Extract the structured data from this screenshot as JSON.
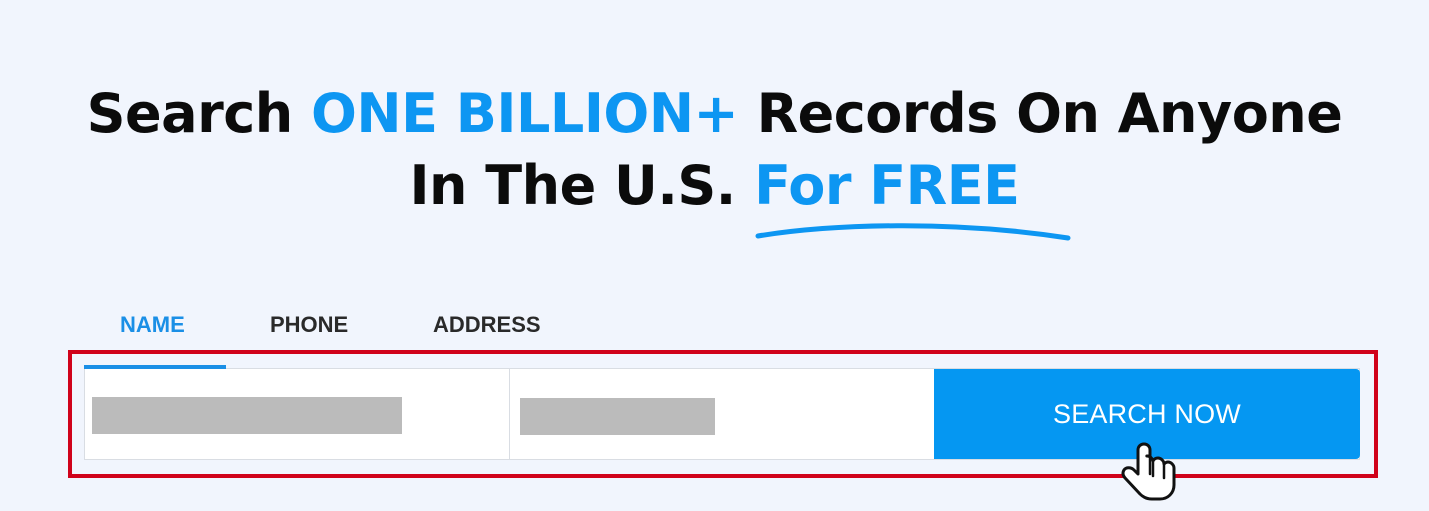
{
  "headline": {
    "line1_part1": "Search ",
    "line1_accent": "ONE BILLION+",
    "line1_part2": " Records On Anyone",
    "line2_part1": "In The U.S. ",
    "line2_accent": "For FREE"
  },
  "tabs": [
    {
      "label": "NAME",
      "active": true
    },
    {
      "label": "PHONE",
      "active": false
    },
    {
      "label": "ADDRESS",
      "active": false
    }
  ],
  "search": {
    "button_label": "SEARCH NOW"
  },
  "colors": {
    "accent": "#0d96f2",
    "button": "#0597f2",
    "highlight_frame": "#d0021b",
    "background": "#f1f5fd"
  },
  "icons": {
    "cursor": "hand-pointer-icon",
    "underline": "swoosh-underline"
  }
}
